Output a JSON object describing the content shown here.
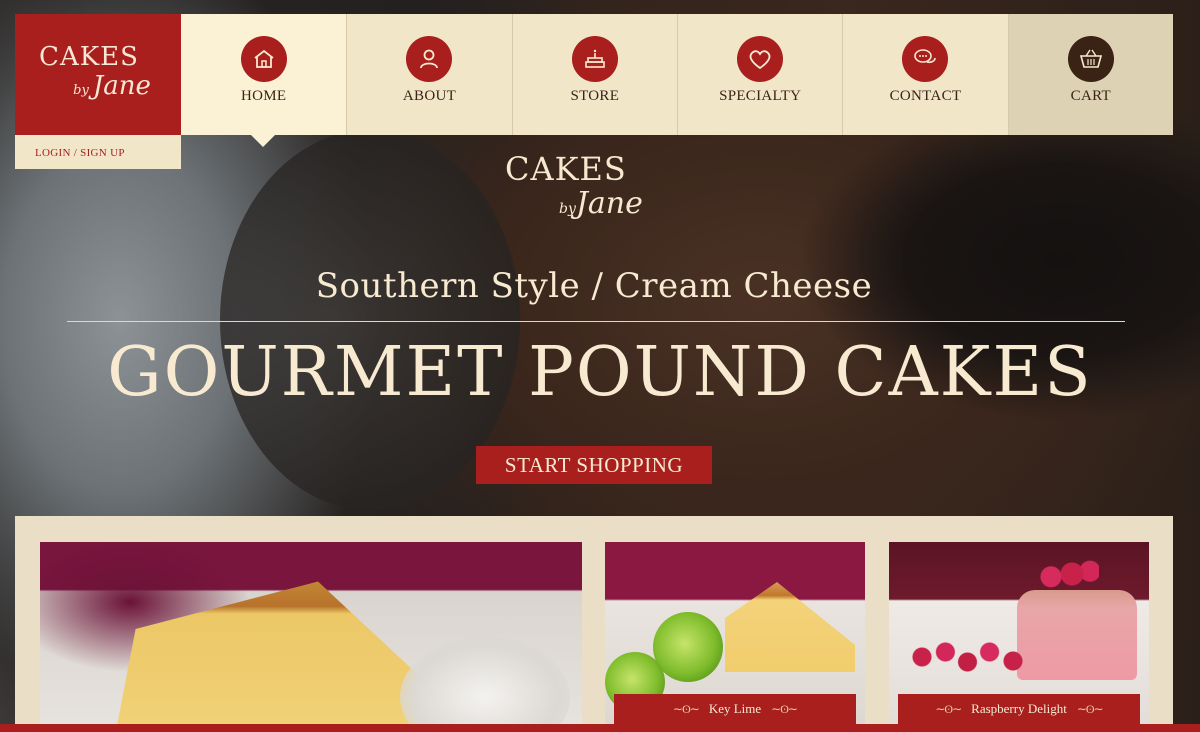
{
  "brand": {
    "logo_word": "CAKES",
    "logo_by": "by",
    "logo_name": "Jane"
  },
  "account": {
    "login_label": "LOGIN / SIGN UP"
  },
  "nav": {
    "items": [
      {
        "label": "HOME",
        "icon": "home-icon"
      },
      {
        "label": "ABOUT",
        "icon": "person-icon"
      },
      {
        "label": "STORE",
        "icon": "birthday-cake-icon"
      },
      {
        "label": "SPECIALTY",
        "icon": "heart-icon"
      },
      {
        "label": "CONTACT",
        "icon": "chat-bubbles-icon"
      },
      {
        "label": "CART",
        "icon": "basket-icon"
      }
    ],
    "active": "HOME"
  },
  "hero": {
    "subtitle": "Southern Style / Cream Cheese",
    "title": "GOURMET POUND CAKES",
    "cta_label": "START SHOPPING"
  },
  "products": [
    {
      "name": "Key Lime"
    },
    {
      "name": "Raspberry Delight"
    }
  ],
  "colors": {
    "brand_red": "#a81f1e",
    "cream": "#f2e6c9",
    "dark_brown": "#3a2215"
  }
}
